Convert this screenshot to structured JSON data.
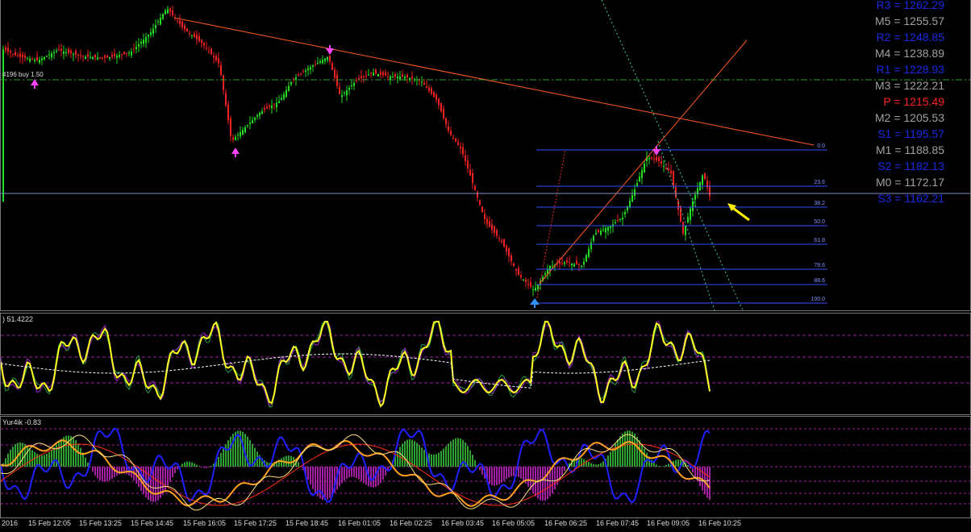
{
  "main_chart": {
    "buy_label": "4196 buy 1.50",
    "fib_levels": [
      {
        "label": "0.0"
      },
      {
        "label": "23.6"
      },
      {
        "label": "38.2"
      },
      {
        "label": "50.0"
      },
      {
        "label": "61.8"
      },
      {
        "label": "78.6"
      },
      {
        "label": "88.6"
      },
      {
        "label": "100.0"
      }
    ],
    "colors": {
      "bull_candle": "#22dd22",
      "bear_candle": "#ee2222",
      "trendline": "#ff5a1e",
      "fib_line": "#4060ff",
      "pivot_line": "#30a030",
      "arrow": "#ffee00"
    }
  },
  "pivot_panel": [
    {
      "label": "R3 = 1262.29",
      "color": "#1a2be0"
    },
    {
      "label": "M5 = 1255.57",
      "color": "#a0a0a0"
    },
    {
      "label": "R2 = 1248.85",
      "color": "#1a2be0"
    },
    {
      "label": "M4 = 1238.89",
      "color": "#a0a0a0"
    },
    {
      "label": "R1 = 1228.93",
      "color": "#1a2be0"
    },
    {
      "label": "M3 = 1222.21",
      "color": "#a0a0a0"
    },
    {
      "label": "P  = 1215.49",
      "color": "#ff2020"
    },
    {
      "label": "M2 = 1205.53",
      "color": "#a0a0a0"
    },
    {
      "label": "S1 = 1195.57",
      "color": "#1a2be0"
    },
    {
      "label": "M1 = 1188.85",
      "color": "#a0a0a0"
    },
    {
      "label": "S2 = 1182.13",
      "color": "#1a2be0"
    },
    {
      "label": "M0 = 1172.17",
      "color": "#a0a0a0"
    },
    {
      "label": "S3 = 1162.21",
      "color": "#1a2be0"
    }
  ],
  "oscillator1": {
    "label": ") 51.4222"
  },
  "oscillator2": {
    "label": "Yur4ik -0.83"
  },
  "time_axis": [
    "2016",
    "15 Feb 12:05",
    "15 Feb 13:25",
    "15 Feb 14:45",
    "15 Feb 16:05",
    "15 Feb 17:25",
    "15 Feb 18:45",
    "16 Feb 01:05",
    "16 Feb 02:25",
    "16 Feb 03:45",
    "16 Feb 05:05",
    "16 Feb 06:25",
    "16 Feb 07:45",
    "16 Feb 09:05",
    "16 Feb 10:25"
  ]
}
